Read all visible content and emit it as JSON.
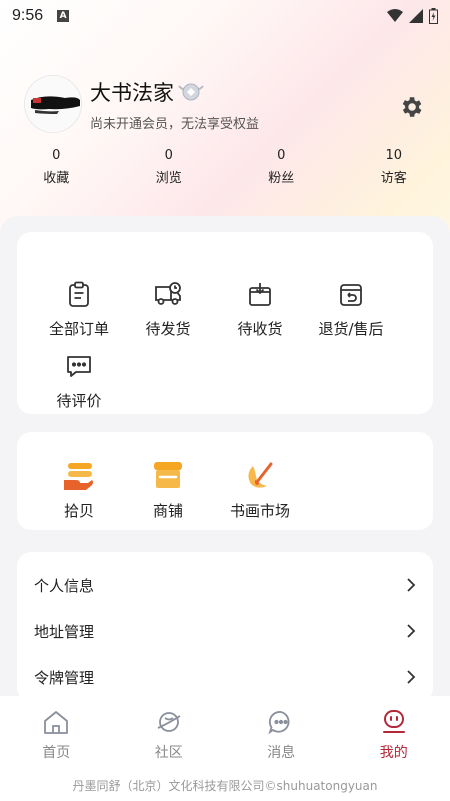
{
  "status_bar": {
    "time": "9:56",
    "a_glyph": "A"
  },
  "profile": {
    "username": "大书法家",
    "membership_note": "尚未开通会员，无法享受权益"
  },
  "stats": [
    {
      "value": "0",
      "label": "收藏"
    },
    {
      "value": "0",
      "label": "浏览"
    },
    {
      "value": "0",
      "label": "粉丝"
    },
    {
      "value": "10",
      "label": "访客"
    }
  ],
  "orders": [
    {
      "label": "全部订单",
      "icon": "clipboard-icon"
    },
    {
      "label": "待发货",
      "icon": "truck-icon"
    },
    {
      "label": "待收货",
      "icon": "box-icon"
    },
    {
      "label": "退货/售后",
      "icon": "return-icon"
    },
    {
      "label": "待评价",
      "icon": "comment-icon"
    }
  ],
  "services": [
    {
      "label": "拾贝",
      "icon": "coins-hand-icon"
    },
    {
      "label": "商铺",
      "icon": "shop-icon"
    },
    {
      "label": "书画市场",
      "icon": "brush-icon"
    }
  ],
  "menu": [
    {
      "label": "个人信息"
    },
    {
      "label": "地址管理"
    },
    {
      "label": "令牌管理"
    }
  ],
  "tabs": [
    {
      "label": "首页",
      "icon": "home-icon"
    },
    {
      "label": "社区",
      "icon": "planet-icon"
    },
    {
      "label": "消息",
      "icon": "chat-icon"
    },
    {
      "label": "我的",
      "icon": "profile-icon",
      "active": true
    }
  ],
  "footer": {
    "text": "丹墨同舒（北京）文化科技有限公司©shuhuatongyuan"
  },
  "colors": {
    "accent": "#b5283a",
    "orange": "#f5a623"
  }
}
